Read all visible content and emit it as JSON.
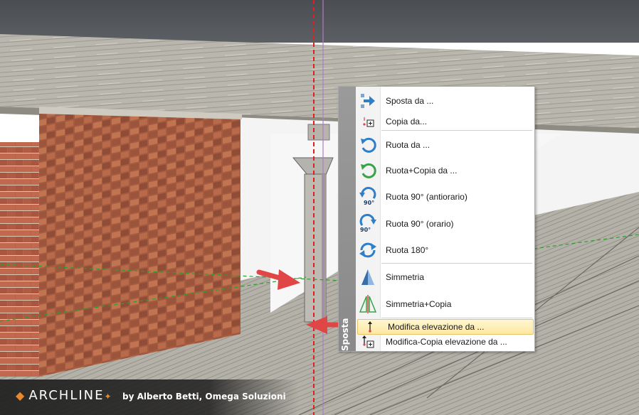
{
  "menu": {
    "panel_label": "Sposta",
    "items": [
      {
        "label": "Sposta da ...",
        "icon": "move-arrow-icon"
      },
      {
        "label": "Copia da...",
        "icon": "copy-plus-icon"
      },
      {
        "label": "Ruota da ...",
        "icon": "rotate-icon"
      },
      {
        "label": "Ruota+Copia da ...",
        "icon": "rotate-copy-icon"
      },
      {
        "label": "Ruota 90° (antiorario)",
        "icon": "rotate-90-ccw-icon",
        "badge": "90°"
      },
      {
        "label": "Ruota 90° (orario)",
        "icon": "rotate-90-cw-icon",
        "badge": "90°"
      },
      {
        "label": "Ruota 180°",
        "icon": "rotate-180-icon"
      },
      {
        "label": "Simmetria",
        "icon": "mirror-icon"
      },
      {
        "label": "Simmetria+Copia",
        "icon": "mirror-copy-icon"
      },
      {
        "label": "Modifica elevazione da ...",
        "icon": "elevation-icon",
        "highlighted": true
      },
      {
        "label": "Modifica-Copia elevazione da ...",
        "icon": "elevation-copy-icon"
      }
    ]
  },
  "watermark": {
    "logo": "ARCHLINE",
    "byline": "by Alberto Betti, Omega Soluzioni"
  },
  "colors": {
    "accent_icon": "#2e7fc9",
    "green_icon": "#3aa24a",
    "callout_arrow": "#e04646",
    "highlight": "#fde7a1",
    "logo_orange": "#e8872b"
  }
}
